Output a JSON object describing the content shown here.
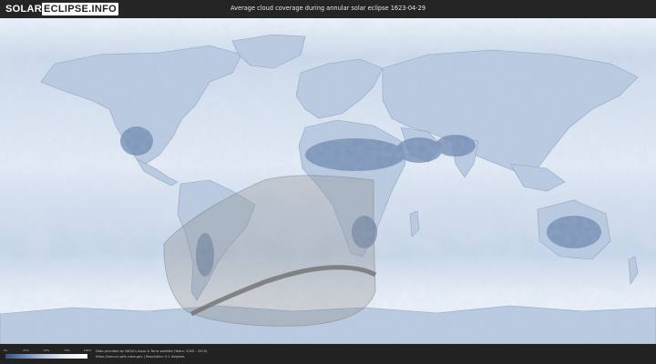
{
  "header": {
    "logo_part1": "SOLAR",
    "logo_part2": "ECLIPSE.INFO",
    "title": "Average cloud coverage during annular solar eclipse 1623-04-29"
  },
  "legend": {
    "ticks": [
      "0%",
      "25%",
      "50%",
      "75%",
      "100%"
    ]
  },
  "footer": {
    "credit_line1": "Data provided by NASA's Aqua & Terra satellite (Years: 2000 - 2019)",
    "credit_line2": "https://neo.sci.gsfc.nasa.gov | Resolution: 0.1 degrees"
  },
  "colors": {
    "ocean": "#dde7f3",
    "land_cloudy": "#c9d6e8",
    "land_clear": "#6c86ad",
    "eclipse_overlay": "#8c8c8c",
    "annular_path": "#707070"
  }
}
